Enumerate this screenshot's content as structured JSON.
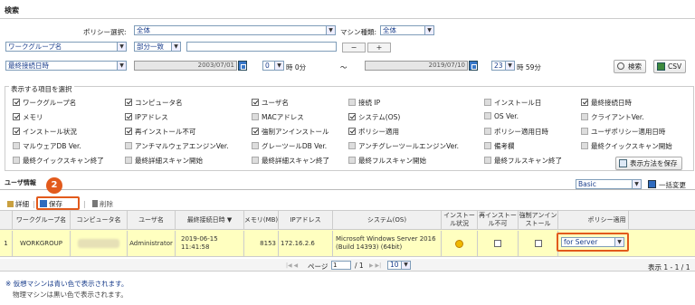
{
  "search": {
    "section_label": "検索",
    "policy_label": "ポリシー選択:",
    "policy_value": "全体",
    "machine_type_label": "マシン種類:",
    "machine_type_value": "全体",
    "field_select": "ワークグループ名",
    "match_select": "部分一致",
    "minus": "−",
    "plus": "+",
    "date_field": "最終接続日時",
    "date_from": "2003/07/01",
    "hour_from": "0",
    "hour_from_suffix": "時 0分",
    "tilde": "〜",
    "date_to": "2019/07/10",
    "hour_to": "23",
    "hour_to_suffix": "時 59分",
    "search_button": "検索",
    "csv_button": "CSV"
  },
  "display_options": {
    "title": "表示する項目を選択",
    "items": [
      {
        "label": "ワークグループ名",
        "checked": "on"
      },
      {
        "label": "コンピュータ名",
        "checked": "on"
      },
      {
        "label": "ユーザ名",
        "checked": "on"
      },
      {
        "label": "接続 IP",
        "checked": "off"
      },
      {
        "label": "インストール日",
        "checked": "off"
      },
      {
        "label": "最終接続日時",
        "checked": "on"
      },
      {
        "label": "メモリ",
        "checked": "on"
      },
      {
        "label": "IPアドレス",
        "checked": "on"
      },
      {
        "label": "MACアドレス",
        "checked": "off"
      },
      {
        "label": "システム(OS)",
        "checked": "on"
      },
      {
        "label": "OS Ver.",
        "checked": "off"
      },
      {
        "label": "クライアントVer.",
        "checked": "off"
      },
      {
        "label": "インストール状況",
        "checked": "on"
      },
      {
        "label": "再インストール不可",
        "checked": "on"
      },
      {
        "label": "強制アンインストール",
        "checked": "on"
      },
      {
        "label": "ポリシー適用",
        "checked": "on"
      },
      {
        "label": "ポリシー適用日時",
        "checked": "off"
      },
      {
        "label": "ユーザポリシー適用日時",
        "checked": "off"
      },
      {
        "label": "マルウェアDB Ver.",
        "checked": "off"
      },
      {
        "label": "アンチマルウェアエンジンVer.",
        "checked": "off"
      },
      {
        "label": "グレーツールDB Ver.",
        "checked": "off"
      },
      {
        "label": "アンチグレーツールエンジンVer.",
        "checked": "off"
      },
      {
        "label": "備考欄",
        "checked": "off"
      },
      {
        "label": "最終クイックスキャン開始",
        "checked": "off"
      },
      {
        "label": "最終クイックスキャン終了",
        "checked": "off"
      },
      {
        "label": "最終詳細スキャン開始",
        "checked": "off"
      },
      {
        "label": "最終詳細スキャン終了",
        "checked": "off"
      },
      {
        "label": "最終フルスキャン開始",
        "checked": "off"
      },
      {
        "label": "最終フルスキャン終了",
        "checked": "off"
      }
    ],
    "save_view_button": "表示方法を保存"
  },
  "user_info": {
    "title": "ユーザ情報",
    "view_select": "Basic",
    "bulk_change": "一括変更",
    "toolbar": {
      "detail": "詳細",
      "save": "保存",
      "delete": "削除"
    },
    "columns": [
      "ワークグループ名",
      "コンピュータ名",
      "ユーザ名",
      "最終接続日時 ▼",
      "メモリ(MB)",
      "IPアドレス",
      "システム(OS)",
      "インストール状況",
      "再インストール不可",
      "強制アンインストール",
      "ポリシー適用"
    ],
    "row": {
      "num": "1",
      "workgroup": "WORKGROUP",
      "computer": "",
      "user": "Administrator",
      "last_conn_date": "2019-06-15",
      "last_conn_time": "11:41:58",
      "memory": "8153",
      "ip": "172.16.2.6",
      "os_line1": "Microsoft Windows Server 2016",
      "os_line2": "(Build 14393) (64bit)",
      "policy": "for Server"
    }
  },
  "pager": {
    "page_label": "ページ",
    "page_value": "1",
    "total": "/ 1",
    "per_page": "10",
    "display_count": "表示 1 - 1 / 1"
  },
  "notes": {
    "line1": "※ 仮想マシンは青い色で表示されます。",
    "line2": "物理マシンは黒い色で表示されます。"
  },
  "callouts": {
    "one": "1",
    "two": "2"
  },
  "colors": {
    "accent": "#e25a1c",
    "row_highlight": "#ffffc0",
    "link": "#1a3e8c"
  }
}
